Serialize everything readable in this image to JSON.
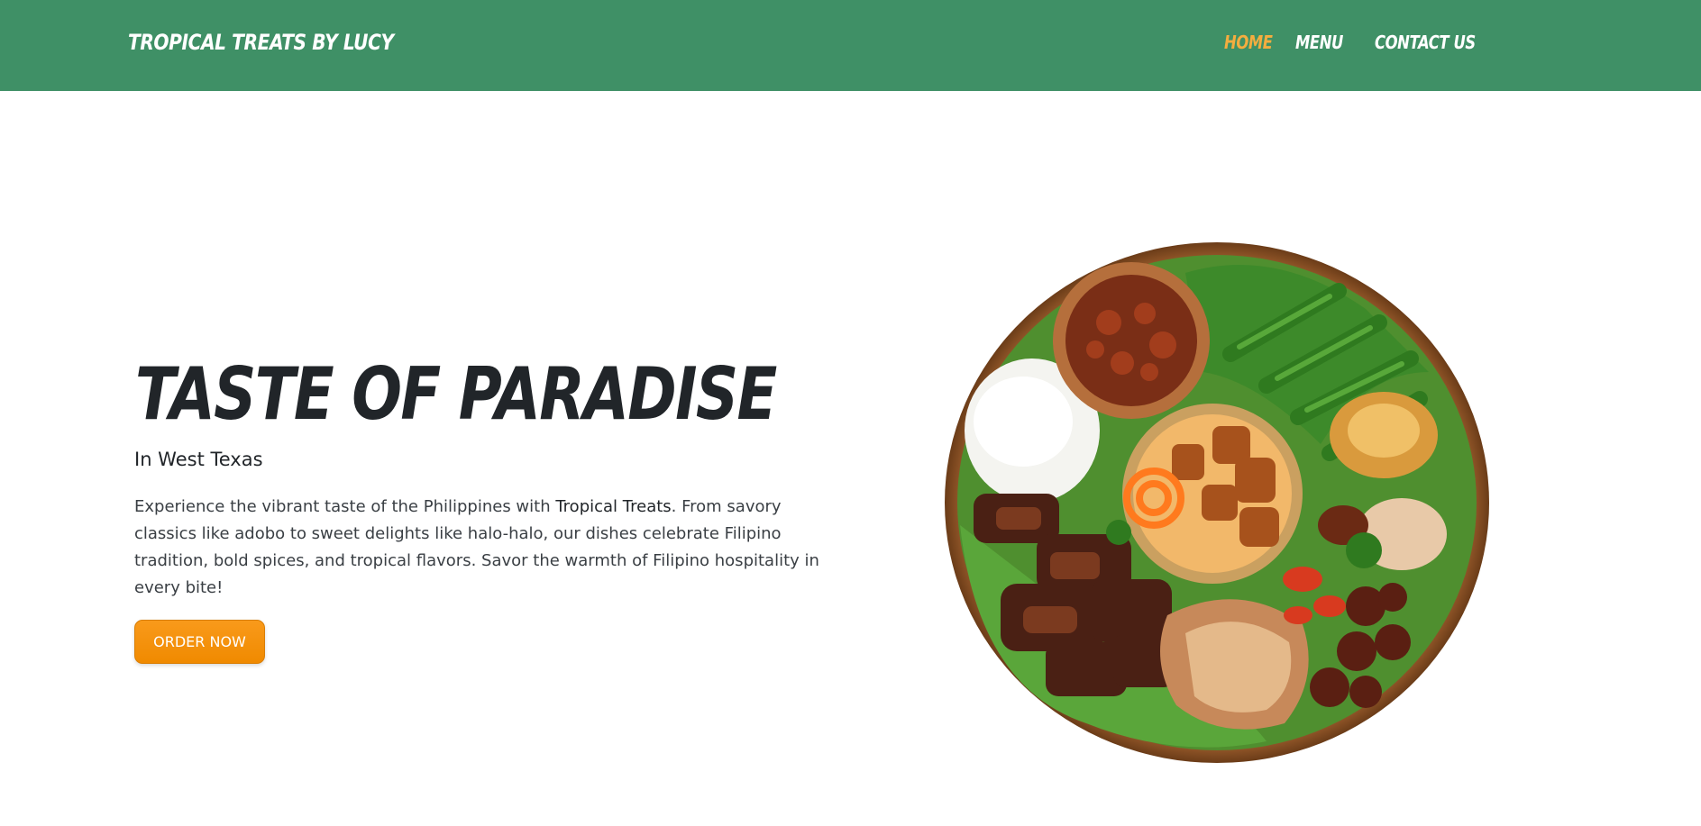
{
  "header": {
    "brand": "TROPICAL TREATS BY LUCY",
    "nav": [
      {
        "label": "HOME",
        "active": true
      },
      {
        "label": "MENU",
        "active": false
      },
      {
        "label": "CONTACT US",
        "active": false
      }
    ]
  },
  "hero": {
    "title": "TASTE OF PARADISE",
    "subtitle": "In West Texas",
    "body_before": "Experience the vibrant taste of the Philippines with ",
    "body_brand": "Tropical Treats",
    "body_after": ". From savory classics like adobo to sweet delights like halo-halo, our dishes celebrate Filipino tradition, bold spices, and tropical flavors. Savor the warmth of Filipino hospitality in every bite!",
    "cta_label": "ORDER NOW",
    "image_icon": "filipino-food-platter"
  },
  "colors": {
    "header_bg": "#3f9066",
    "nav_active": "#f4ad3f",
    "cta": "#f5920f",
    "text": "#212529"
  }
}
